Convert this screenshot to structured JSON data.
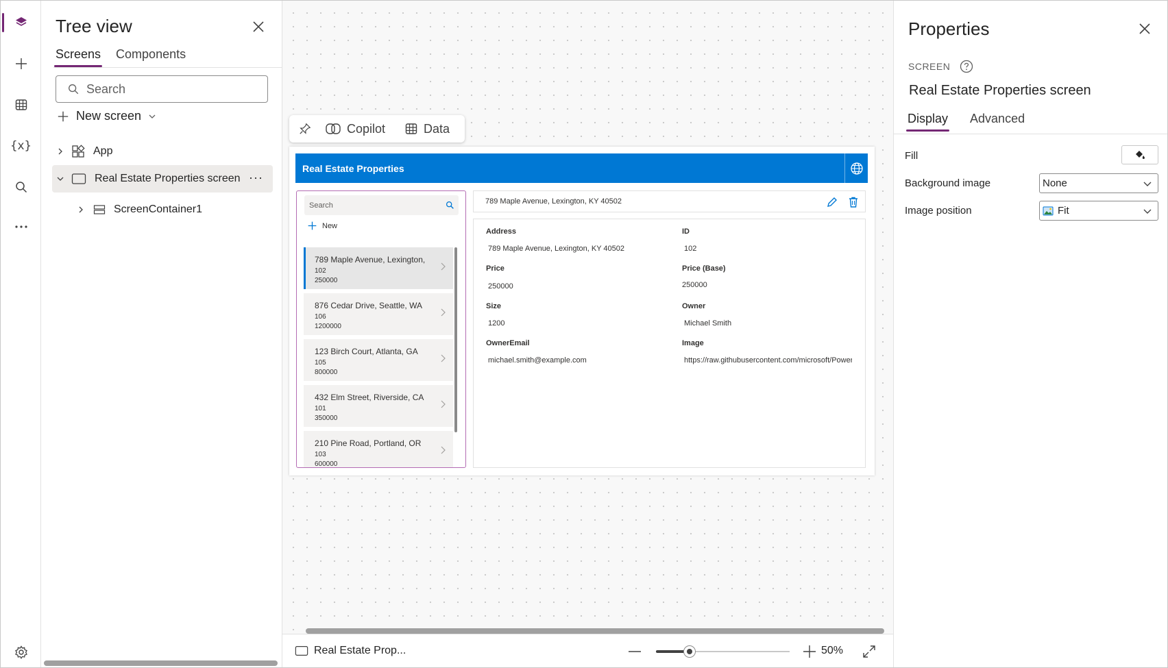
{
  "rail": {
    "items": [
      "layers-icon",
      "plus-icon",
      "table-icon",
      "variables-icon",
      "search-icon",
      "more-icon"
    ],
    "variables_label": "{x}",
    "settings": "settings-icon",
    "accent": "#742774"
  },
  "tree": {
    "title": "Tree view",
    "tabs": [
      "Screens",
      "Components"
    ],
    "search_placeholder": "Search",
    "new_screen_label": "New screen",
    "nodes": {
      "app": "App",
      "screen": "Real Estate Properties screen",
      "container": "ScreenContainer1"
    },
    "more_label": "···"
  },
  "toolbar": {
    "copilot": "Copilot",
    "data": "Data"
  },
  "app": {
    "header_title": "Real Estate Properties",
    "header_color": "#0078d4",
    "list_search_placeholder": "Search",
    "new_label": "New",
    "items": [
      {
        "address": "789 Maple Avenue, Lexington,",
        "id": "102",
        "price": "250000"
      },
      {
        "address": "876 Cedar Drive, Seattle, WA",
        "id": "106",
        "price": "1200000"
      },
      {
        "address": "123 Birch Court, Atlanta, GA",
        "id": "105",
        "price": "800000"
      },
      {
        "address": "432 Elm Street, Riverside, CA",
        "id": "101",
        "price": "350000"
      },
      {
        "address": "210 Pine Road, Portland, OR",
        "id": "103",
        "price": "600000"
      }
    ],
    "detail_title": "789 Maple Avenue, Lexington, KY 40502",
    "fields": {
      "address_label": "Address",
      "address_value": "789 Maple Avenue, Lexington, KY 40502",
      "id_label": "ID",
      "id_value": "102",
      "price_label": "Price",
      "price_value": "250000",
      "pricebase_label": "Price (Base)",
      "pricebase_value": "250000",
      "size_label": "Size",
      "size_value": "1200",
      "owner_label": "Owner",
      "owner_value": "Michael Smith",
      "email_label": "OwnerEmail",
      "email_value": "michael.smith@example.com",
      "image_label": "Image",
      "image_value": "https://raw.githubusercontent.com/microsoft/Power"
    }
  },
  "status": {
    "screen_name": "Real Estate Prop...",
    "zoom": "50%",
    "zoom_level": 0.25
  },
  "properties": {
    "title": "Properties",
    "kind": "SCREEN",
    "screen_name": "Real Estate Properties screen",
    "tabs": [
      "Display",
      "Advanced"
    ],
    "fill_label": "Fill",
    "bg_image_label": "Background image",
    "bg_image_value": "None",
    "image_pos_label": "Image position",
    "image_pos_value": "Fit"
  }
}
